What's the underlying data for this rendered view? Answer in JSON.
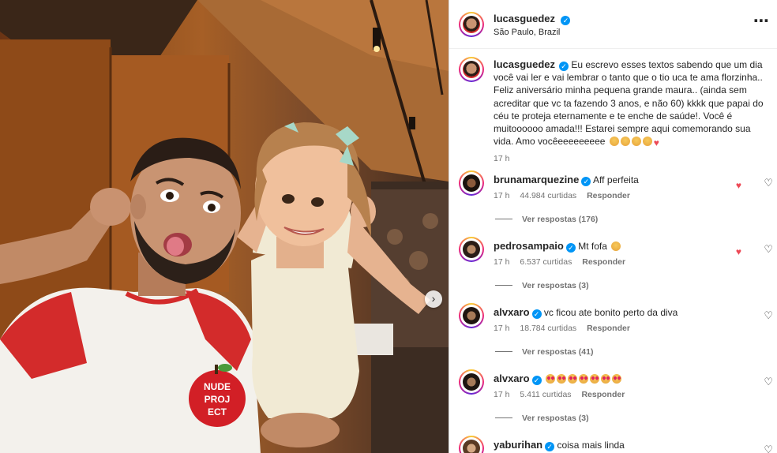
{
  "post": {
    "username": "lucasguedez",
    "location": "São Paulo, Brazil",
    "caption_text": "Eu escrevo esses textos sabendo que um dia você vai ler e vai lembrar o tanto que o tio uca te ama florzinha.. Feliz aniversário minha pequena grande maura.. (ainda sem acreditar que vc ta fazendo 3 anos, e não 60) kkkk que papai do céu te proteja eternamente e te enche de saúde!. Você é muitoooooo amada!!! Estarei sempre aqui comemorando sua vida. Amo vocêeeeeeeeee",
    "caption_time": "17 h",
    "more_icon": "⋯"
  },
  "photo": {
    "shirt_print": [
      "NUDE",
      "PROJ",
      "ECT"
    ],
    "next_icon": "›"
  },
  "comments": [
    {
      "username": "brunamarquezine",
      "text": "Aff perfeita",
      "time": "17 h",
      "likes": "44.984 curtidas",
      "reply": "Responder",
      "replies": "Ver respostas (176)"
    },
    {
      "username": "pedrosampaio",
      "text": "Mt fofa",
      "time": "17 h",
      "likes": "6.537 curtidas",
      "reply": "Responder",
      "replies": "Ver respostas (3)"
    },
    {
      "username": "alvxaro",
      "text": "vc ficou ate bonito perto da diva",
      "time": "17 h",
      "likes": "18.784 curtidas",
      "reply": "Responder",
      "replies": "Ver respostas (41)"
    },
    {
      "username": "alvxaro",
      "text": "",
      "time": "17 h",
      "likes": "5.411 curtidas",
      "reply": "Responder",
      "replies": "Ver respostas (3)"
    },
    {
      "username": "yaburihan",
      "text": "coisa mais linda",
      "time": "",
      "likes": "",
      "reply": "",
      "replies": ""
    }
  ],
  "icons": {
    "heart_outline": "♡",
    "heart_emoji": "♥",
    "verified": "✓"
  }
}
